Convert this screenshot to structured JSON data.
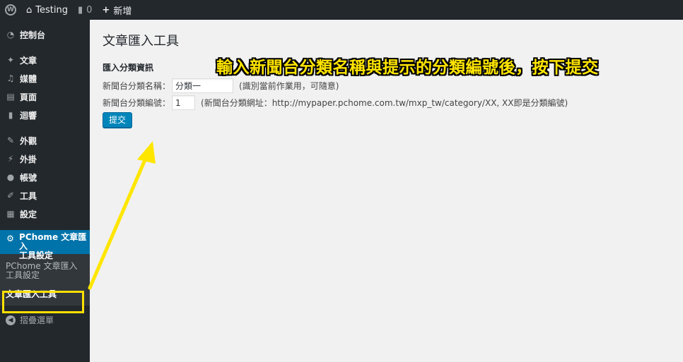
{
  "adminbar": {
    "site_name": "Testing",
    "comments_count": "0",
    "new_label": "新增"
  },
  "sidebar": {
    "items": [
      {
        "label": "控制台",
        "icon": "dashboard-icon"
      },
      {
        "label": "文章",
        "icon": "pushpin-icon"
      },
      {
        "label": "媒體",
        "icon": "media-icon"
      },
      {
        "label": "頁面",
        "icon": "page-icon"
      },
      {
        "label": "迴響",
        "icon": "comment-icon"
      },
      {
        "label": "外觀",
        "icon": "brush-icon"
      },
      {
        "label": "外掛",
        "icon": "plugin-icon"
      },
      {
        "label": "帳號",
        "icon": "user-icon"
      },
      {
        "label": "工具",
        "icon": "wrench-icon"
      },
      {
        "label": "設定",
        "icon": "settings-icon"
      }
    ],
    "current_menu": {
      "label_line1": "PChome 文章匯入",
      "label_line2": "工具設定",
      "icon": "gear-icon"
    },
    "submenu": [
      {
        "label_line1": "PChome 文章匯入",
        "label_line2": "工具設定"
      },
      {
        "label": "文章匯入工具"
      }
    ],
    "collapse_label": "摺疊選單"
  },
  "main": {
    "page_title": "文章匯入工具",
    "section_title": "匯入分類資訊",
    "name_label": "新聞台分類名稱：",
    "name_value": "分類一",
    "name_hint": "(識別當前作業用，可隨意)",
    "number_label": "新聞台分類編號：",
    "number_value": "1",
    "number_hint": "(新聞台分類網址：http://mypaper.pchome.com.tw/mxp_tw/category/XX, XX即是分類編號)",
    "submit_label": "提交"
  },
  "annotation": {
    "text": "輸入新聞台分類名稱與提示的分類編號後，按下提交"
  },
  "colors": {
    "admin_bg": "#23282d",
    "accent": "#0073aa",
    "button": "#0085ba",
    "annotation": "#ffe500"
  }
}
